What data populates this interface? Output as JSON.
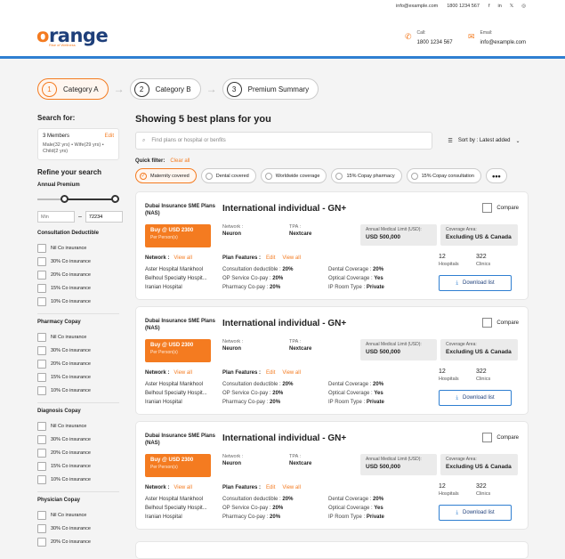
{
  "topbar": {
    "email": "info@example.com",
    "phone": "1800 1234 567",
    "social": [
      "f",
      "in",
      "𝕏",
      "◎"
    ]
  },
  "header": {
    "logo_o": "o",
    "logo_rest": "range",
    "logo_r": "r",
    "tagline": "Rise of Wellness",
    "call_label": "Call:",
    "call_value": "1800 1234 567",
    "email_label": "Email:",
    "email_value": "info@example.com"
  },
  "steps": [
    {
      "num": "1",
      "label": "Category A"
    },
    {
      "num": "2",
      "label": "Category B"
    },
    {
      "num": "3",
      "label": "Premium Summary"
    }
  ],
  "sidebar": {
    "search_for": "Search for:",
    "members": "3 Members",
    "edit": "Edit",
    "members_detail": "Male(32 yrs) • Wife(29 yrs) • Child(2 yrs)",
    "refine": "Refine your search",
    "annual_premium": "Annual Premium",
    "min_placeholder": "Min",
    "max_value": "72234",
    "groups": [
      {
        "title": "Consultation Deductible",
        "options": [
          "Nil Co insurance",
          "30% Co insurance",
          "20% Co insurance",
          "15% Co insurance",
          "10% Co insurance"
        ]
      },
      {
        "title": "Pharmacy Copay",
        "options": [
          "Nil Co insurance",
          "30% Co insurance",
          "20% Co insurance",
          "15% Co insurance",
          "10% Co insurance"
        ]
      },
      {
        "title": "Diagnosis Copay",
        "options": [
          "Nil Co insurance",
          "30% Co insurance",
          "20% Co insurance",
          "15% Co insurance",
          "10% Co insurance"
        ]
      },
      {
        "title": "Physician Copay",
        "options": [
          "Nil Co insurance",
          "30% Co insurance",
          "20% Co insurance"
        ]
      }
    ]
  },
  "main": {
    "title": "Showing 5 best plans for you",
    "search_placeholder": "Find plans or hospital or benfits",
    "sort": "Sort by : Latest added",
    "quick_filter": "Quick filter:",
    "clear_all": "Clear all",
    "chips": [
      "Maternity covered",
      "Dental covered",
      "Worldwide coverage",
      "15% Copay pharmacy",
      "15% Copay consultation"
    ],
    "more": "•••"
  },
  "cards": [
    {
      "insurer": "Dubai Insurance SME Plans (NAS)",
      "plan": "International individual - GN+",
      "compare": "Compare",
      "buy": "Buy @ USD 2300",
      "buy_sub": "Per Person(s)",
      "network_label": "Network :",
      "network": "Neuron",
      "tpa_label": "TPA :",
      "tpa": "Nextcare",
      "aml_label": "Annual Medical Limit (USD):",
      "aml": "USD 500,000",
      "cov_label": "Coverage Area:",
      "cov": "Excluding US & Canada",
      "net_title": "Network :",
      "view_all": "View all",
      "hospitals": [
        "Aster Hospital Mankhool",
        "Belhoul Specialty Hospit...",
        "Iranian Hospital"
      ],
      "pf_title": "Plan Features :",
      "pf_edit": "Edit",
      "pf_view": "View all",
      "f1l": "Consultation deductible :",
      "f1v": "20%",
      "f2l": "OP Service Co-pay :",
      "f2v": "20%",
      "f3l": "Pharmacy Co-pay :",
      "f3v": "20%",
      "f4l": "Dental Coverage :",
      "f4v": "20%",
      "f5l": "Optical Coverage :",
      "f5v": "Yes",
      "f6l": "IP Room Type :",
      "f6v": "Private",
      "hosp_n": "12",
      "hosp_l": "Hospitals",
      "clin_n": "322",
      "clin_l": "Clinics",
      "download": "Download list"
    },
    {
      "insurer": "Dubai Insurance SME Plans (NAS)",
      "plan": "International individual - GN+",
      "compare": "Compare",
      "buy": "Buy @ USD 2300",
      "buy_sub": "Per Person(s)",
      "network_label": "Network :",
      "network": "Neuron",
      "tpa_label": "TPA :",
      "tpa": "Nextcare",
      "aml_label": "Annual Medical Limit (USD):",
      "aml": "USD 500,000",
      "cov_label": "Coverage Area:",
      "cov": "Excluding US & Canada",
      "net_title": "Network :",
      "view_all": "View all",
      "hospitals": [
        "Aster Hospital Mankhool",
        "Belhoul Specialty Hospit...",
        "Iranian Hospital"
      ],
      "pf_title": "Plan Features :",
      "pf_edit": "Edit",
      "pf_view": "View all",
      "f1l": "Consultation deductible :",
      "f1v": "20%",
      "f2l": "OP Service Co-pay :",
      "f2v": "20%",
      "f3l": "Pharmacy Co-pay :",
      "f3v": "20%",
      "f4l": "Dental Coverage :",
      "f4v": "20%",
      "f5l": "Optical Coverage :",
      "f5v": "Yes",
      "f6l": "IP Room Type :",
      "f6v": "Private",
      "hosp_n": "12",
      "hosp_l": "Hospitals",
      "clin_n": "322",
      "clin_l": "Clinics",
      "download": "Download list"
    },
    {
      "insurer": "Dubai Insurance SME Plans (NAS)",
      "plan": "International individual - GN+",
      "compare": "Compare",
      "buy": "Buy @ USD 2300",
      "buy_sub": "Per Person(s)",
      "network_label": "Network :",
      "network": "Neuron",
      "tpa_label": "TPA :",
      "tpa": "Nextcare",
      "aml_label": "Annual Medical Limit (USD):",
      "aml": "USD 500,000",
      "cov_label": "Coverage Area:",
      "cov": "Excluding US & Canada",
      "net_title": "Network :",
      "view_all": "View all",
      "hospitals": [
        "Aster Hospital Mankhool",
        "Belhoul Specialty Hospit...",
        "Iranian Hospital"
      ],
      "pf_title": "Plan Features :",
      "pf_edit": "Edit",
      "pf_view": "View all",
      "f1l": "Consultation deductible :",
      "f1v": "20%",
      "f2l": "OP Service Co-pay :",
      "f2v": "20%",
      "f3l": "Pharmacy Co-pay :",
      "f3v": "20%",
      "f4l": "Dental Coverage :",
      "f4v": "20%",
      "f5l": "Optical Coverage :",
      "f5v": "Yes",
      "f6l": "IP Room Type :",
      "f6v": "Private",
      "hosp_n": "12",
      "hosp_l": "Hospitals",
      "clin_n": "322",
      "clin_l": "Clinics",
      "download": "Download list"
    }
  ],
  "colors": {
    "accent": "#f47b20",
    "brand": "#1e3f7a",
    "link": "#2f7fd1"
  }
}
